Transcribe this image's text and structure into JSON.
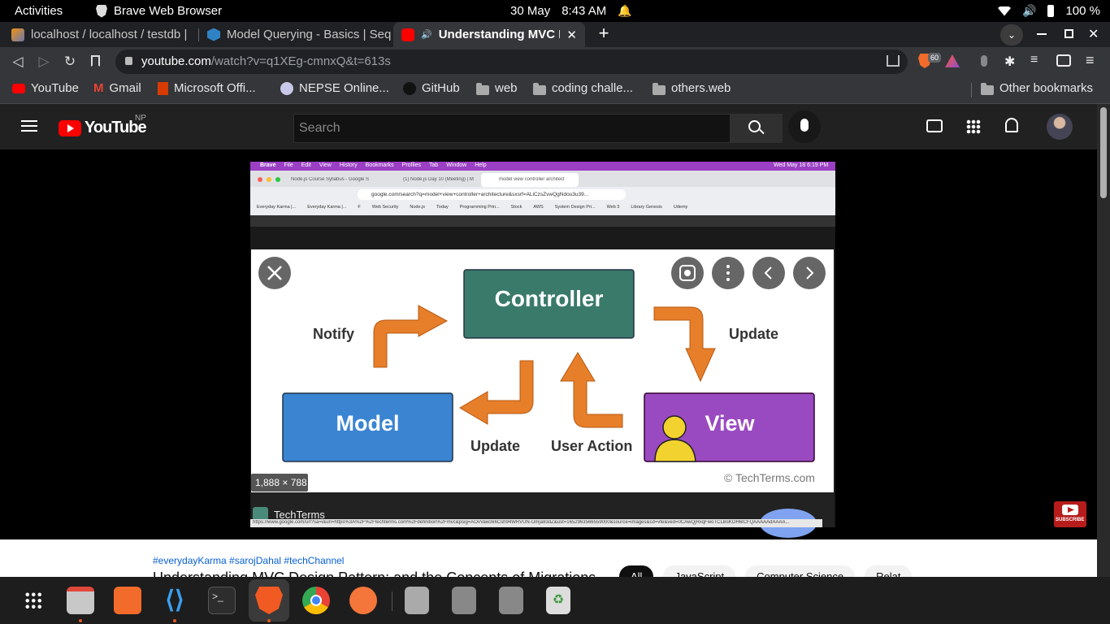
{
  "system": {
    "activities": "Activities",
    "app_name": "Brave Web Browser",
    "date": "30 May",
    "time": "8:43 AM",
    "battery": "100 %"
  },
  "tabs": [
    {
      "title": "localhost / localhost / testdb |"
    },
    {
      "title": "Model Querying - Basics | Seq"
    },
    {
      "title": "Understanding MVC De"
    }
  ],
  "address": {
    "host": "youtube.com",
    "path": "/watch?v=q1XEg-cmnxQ&t=613s"
  },
  "brave_badge": "60",
  "bookmarks": [
    "YouTube",
    "Gmail",
    "Microsoft Offi...",
    "NEPSE Online...",
    "GitHub",
    "web",
    "coding challe...",
    "others.web"
  ],
  "other_bookmarks": "Other bookmarks",
  "youtube": {
    "logo": "YouTube",
    "region": "NP",
    "search_placeholder": "Search"
  },
  "video_screen": {
    "mac_menu": [
      "Brave",
      "File",
      "Edit",
      "View",
      "History",
      "Bookmarks",
      "Profiles",
      "Tab",
      "Window",
      "Help"
    ],
    "mac_clock": "Wed May 18  6:19 PM",
    "inner_tabs": [
      "Node.js Course Syllabus - Google S",
      "(1) Node.js Day 10 (Meeting) | M",
      "model view controller architect"
    ],
    "inner_url": "google.com/search?q=model+view+controller+architecture&sxsrf=ALiCzsZvwQgNdou3u39...",
    "inner_bookmarks": [
      "Everyday Karma |...",
      "Everyday Karma |...",
      "F",
      "Web Security",
      "Node.js",
      "Today",
      "Programming Prin...",
      "Stock",
      "AWS",
      "System Design Pri...",
      "Web 3",
      "Library Genesis",
      "Udemy"
    ],
    "diagram": {
      "controller": "Controller",
      "model": "Model",
      "view": "View",
      "notify": "Notify",
      "update_right": "Update",
      "update_bottom": "Update",
      "user_action": "User Action",
      "credit": "© TechTerms.com",
      "size": "1,888 × 788"
    },
    "source": "TechTerms",
    "status_url": "https://www.google.com/url?sa=i&url=https%3A%2F%2Ftechterms.com%2Fdefinition%2Fmvc&psig=AOvVaw3k6Csh94WRVUN-Omja83dZ&ust=1652963566559000&source=images&cd=vfe&ved=0CAwQjRxqFwoTCLBsKOH6lCFQAAAAAdAAAA..."
  },
  "subscribe": "SUBSCRIBE",
  "below": {
    "hashtags": "#everydayKarma #sarojDahal #techChannel",
    "title": "Understanding MVC Design Pattern: and the Concepts of Migrations",
    "chips": [
      "All",
      "JavaScript",
      "Computer Science",
      "Relat"
    ]
  },
  "colors": {
    "controller": "#3a7a6a",
    "model": "#3a84d2",
    "view": "#9a4ac0",
    "arrow": "#e67e2a"
  }
}
